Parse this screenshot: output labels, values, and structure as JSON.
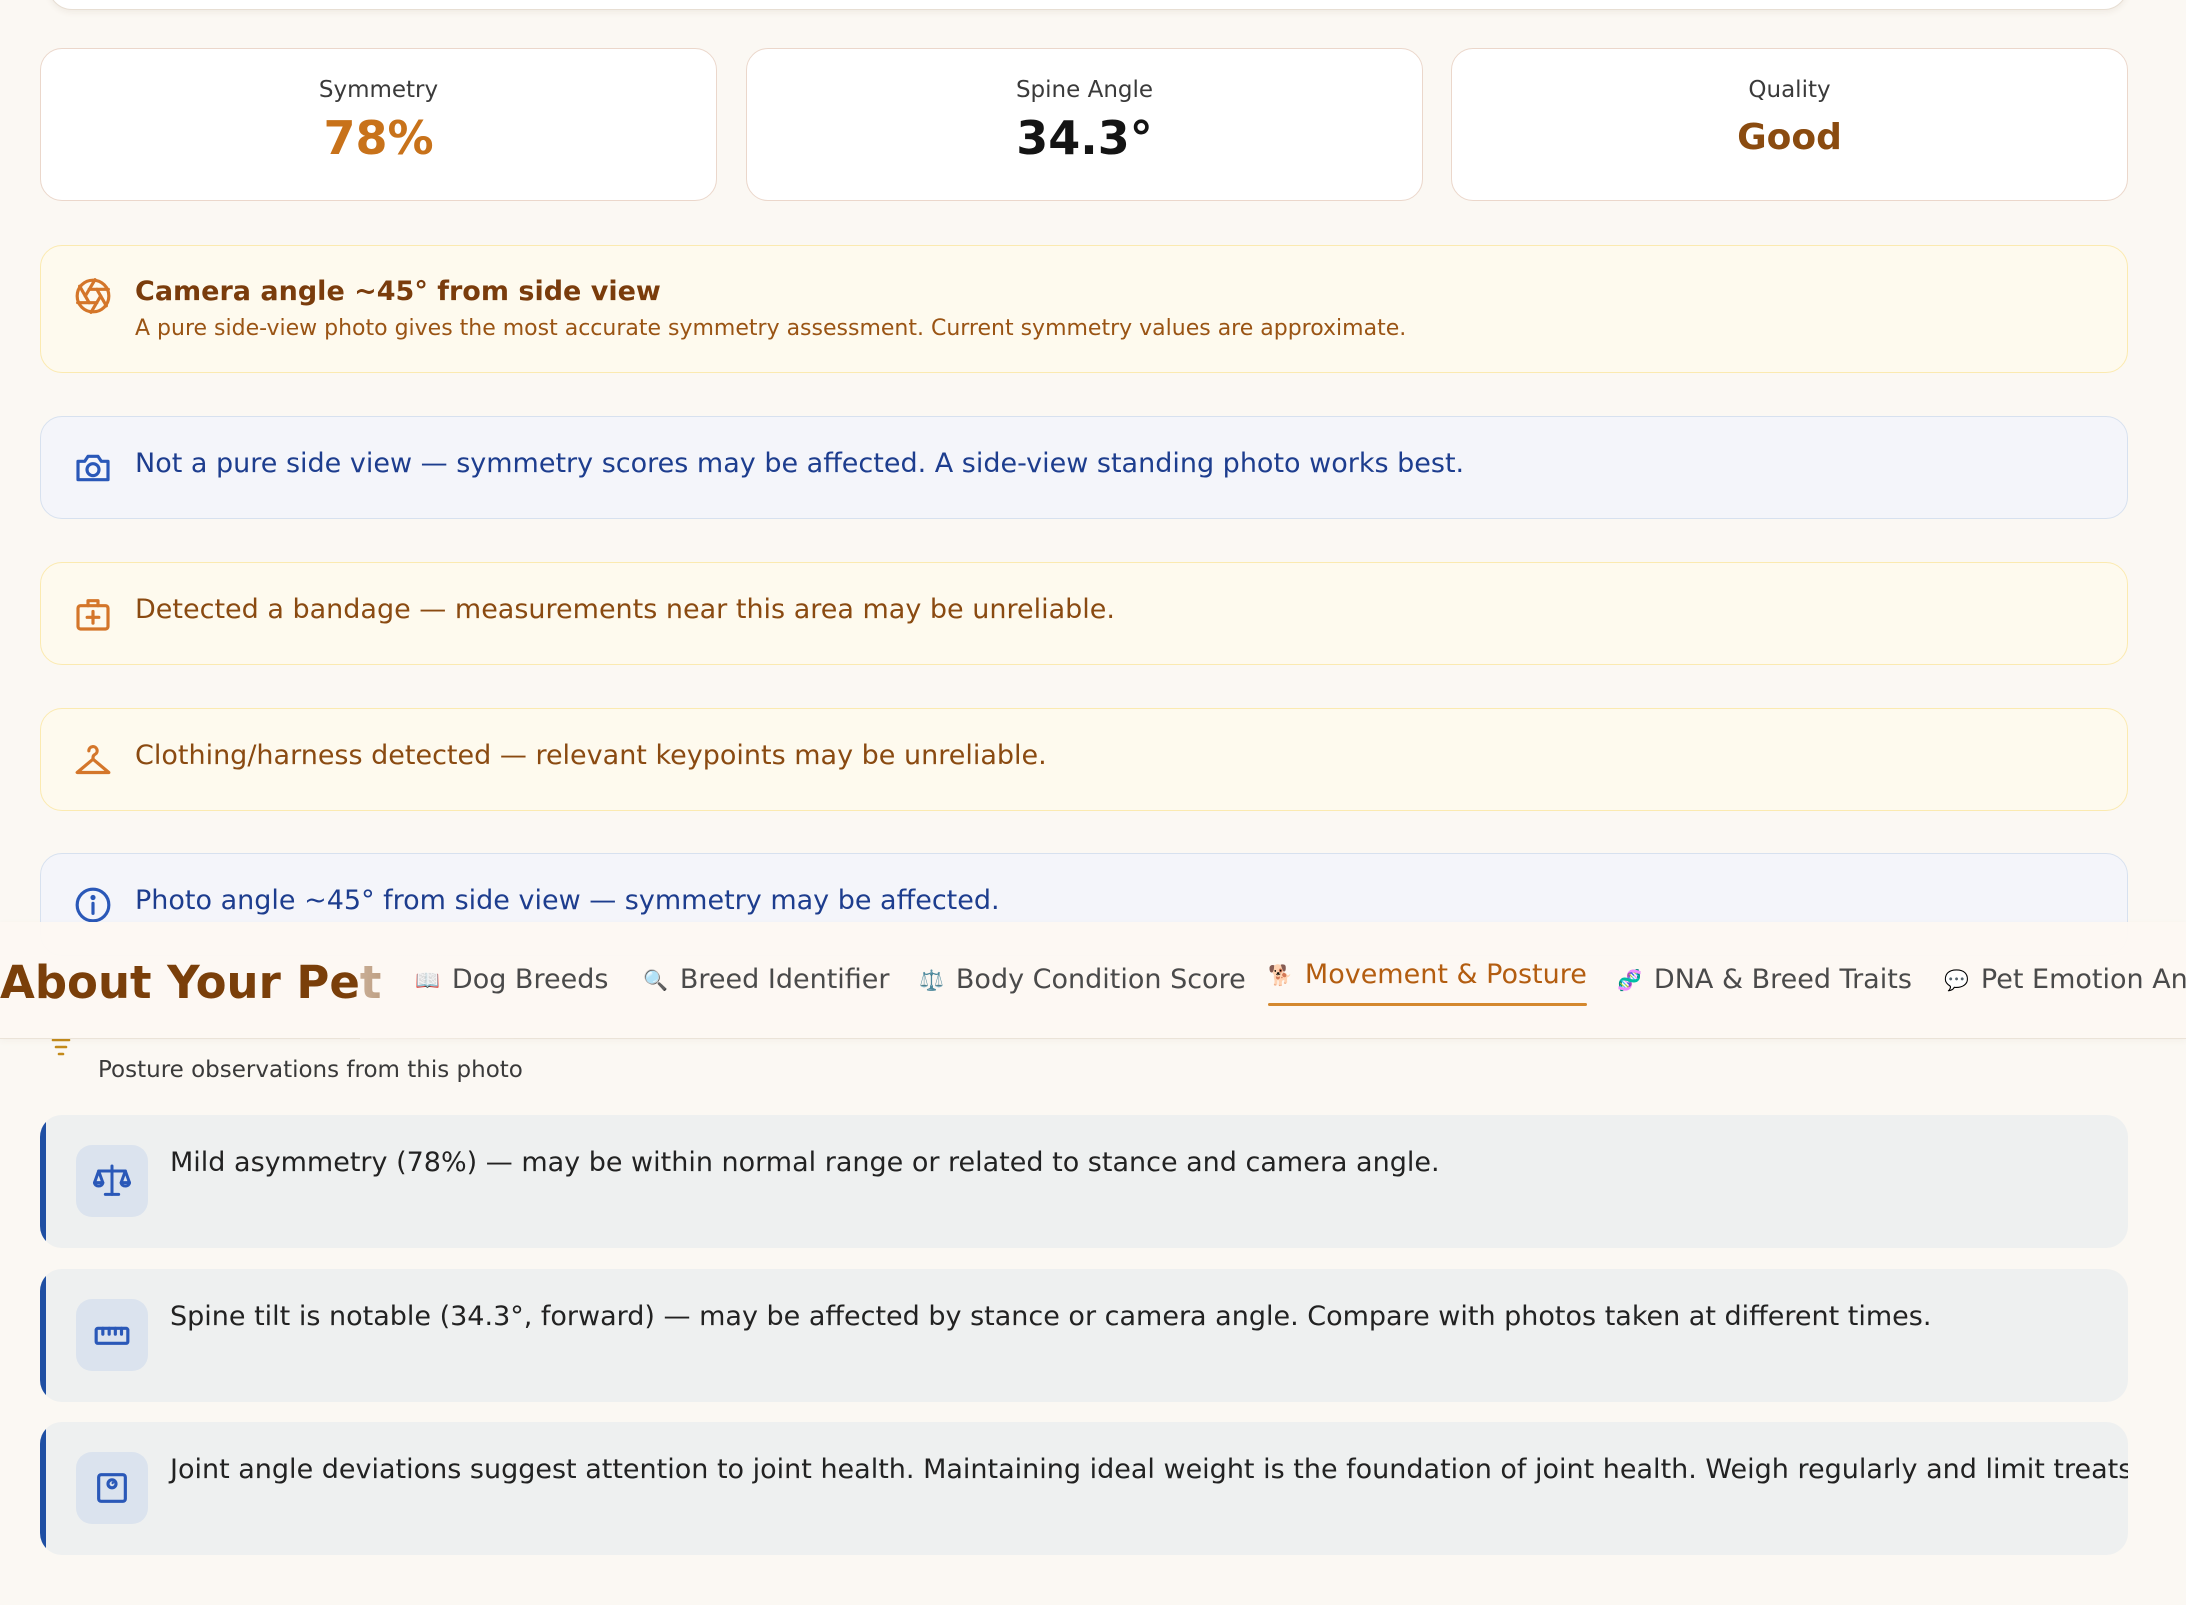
{
  "metrics": [
    {
      "label": "Symmetry",
      "value": "78%",
      "color": "#c8721a"
    },
    {
      "label": "Spine Angle",
      "value": "34.3°",
      "color": "#141414"
    },
    {
      "label": "Quality",
      "value": "Good",
      "color": "#8a4b10"
    }
  ],
  "alerts": {
    "camera_angle": {
      "icon": "aperture-icon",
      "title": "Camera angle ~45° from side view",
      "text": "A pure side-view photo gives the most accurate symmetry assessment. Current symmetry values are approximate."
    },
    "side_view": {
      "icon": "camera-icon",
      "text": "Not a pure side view — symmetry scores may be affected. A side-view standing photo works best."
    },
    "bandage": {
      "icon": "medical-kit-icon",
      "text": "Detected a bandage — measurements near this area may be unreliable."
    },
    "clothing": {
      "icon": "hanger-icon",
      "text": "Clothing/harness detected — relevant keypoints may be unreliable."
    },
    "photo_angle": {
      "icon": "info-icon",
      "text": "Photo angle ~45° from side view — symmetry may be affected."
    }
  },
  "nav": {
    "brand": "About Your Pet",
    "items": [
      {
        "emoji": "📖",
        "label": "Dog Breeds",
        "icon": "book-icon"
      },
      {
        "emoji": "🔍",
        "label": "Breed Identifier",
        "icon": "magnifier-icon"
      },
      {
        "emoji": "⚖️",
        "label": "Body Condition Score",
        "icon": "scale-icon"
      },
      {
        "emoji": "🐕",
        "label": "Movement & Posture",
        "icon": "dog-icon",
        "active": true
      },
      {
        "emoji": "🧬",
        "label": "DNA & Breed Traits",
        "icon": "dna-icon"
      },
      {
        "emoji": "💬",
        "label": "Pet Emotion Ana",
        "icon": "speech-bubble-icon"
      }
    ]
  },
  "section": {
    "subtitle": "Posture observations from this photo"
  },
  "observations": [
    {
      "icon": "balance-icon",
      "text": "Mild asymmetry (78%) — may be within normal range or related to stance and camera angle."
    },
    {
      "icon": "ruler-icon",
      "text": "Spine tilt is notable (34.3°, forward) — may be affected by stance or camera angle. Compare with photos taken at different times."
    },
    {
      "icon": "weight-scale-icon",
      "text": "Joint angle deviations suggest attention to joint health. Maintaining ideal weight is the foundation of joint health. Weigh regularly and limit treats."
    }
  ]
}
